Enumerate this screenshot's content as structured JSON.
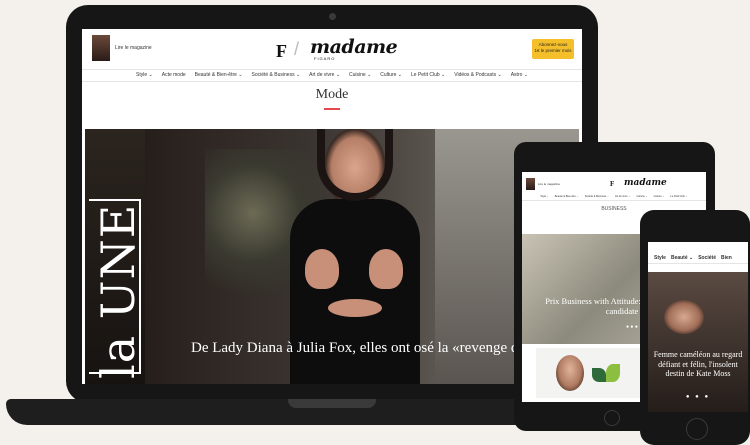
{
  "laptop": {
    "magazine_link": "Lire le magazine",
    "logo_mark": "F",
    "logo_text": "madame",
    "logo_sub": "FIGARO",
    "subscribe_line1": "Abonnez-vous",
    "subscribe_line2": "1€ le premier mois",
    "nav": [
      "Style ⌄",
      "Acte mode",
      "Beauté & Bien-être ⌄",
      "Société & Business ⌄",
      "Art de vivre ⌄",
      "Cuisine ⌄",
      "Culture ⌄",
      "Le Petit Club ⌄",
      "Vidéos & Podcasts ⌄",
      "Astro ⌄"
    ],
    "section_title": "Mode",
    "une_label": "la UNE",
    "hero_title": "De Lady Diana à Julia Fox, elles ont osé la «revenge dress»"
  },
  "tablet": {
    "magazine_link": "Lire le magazine",
    "logo_mark": "F",
    "logo_text": "madame",
    "nav": [
      "Style ⌄",
      "Beauté & Bien-être ⌄",
      "Société & Business ⌄",
      "Art de vivre ⌄",
      "Cuisine ⌄",
      "Culture ⌄",
      "Le Petit Club ⌄"
    ],
    "section_title": "BUSINESS",
    "hero_title": "Prix Business with Attitude: votez pour votre candidate",
    "dots": "● ● ●"
  },
  "phone": {
    "nav": [
      "Style",
      "Beauté ⌄",
      "Société",
      "Bien"
    ],
    "hero_title": "Femme caméléon au regard défiant et félin, l'insolent destin de Kate Moss",
    "social": "● ● ●"
  }
}
